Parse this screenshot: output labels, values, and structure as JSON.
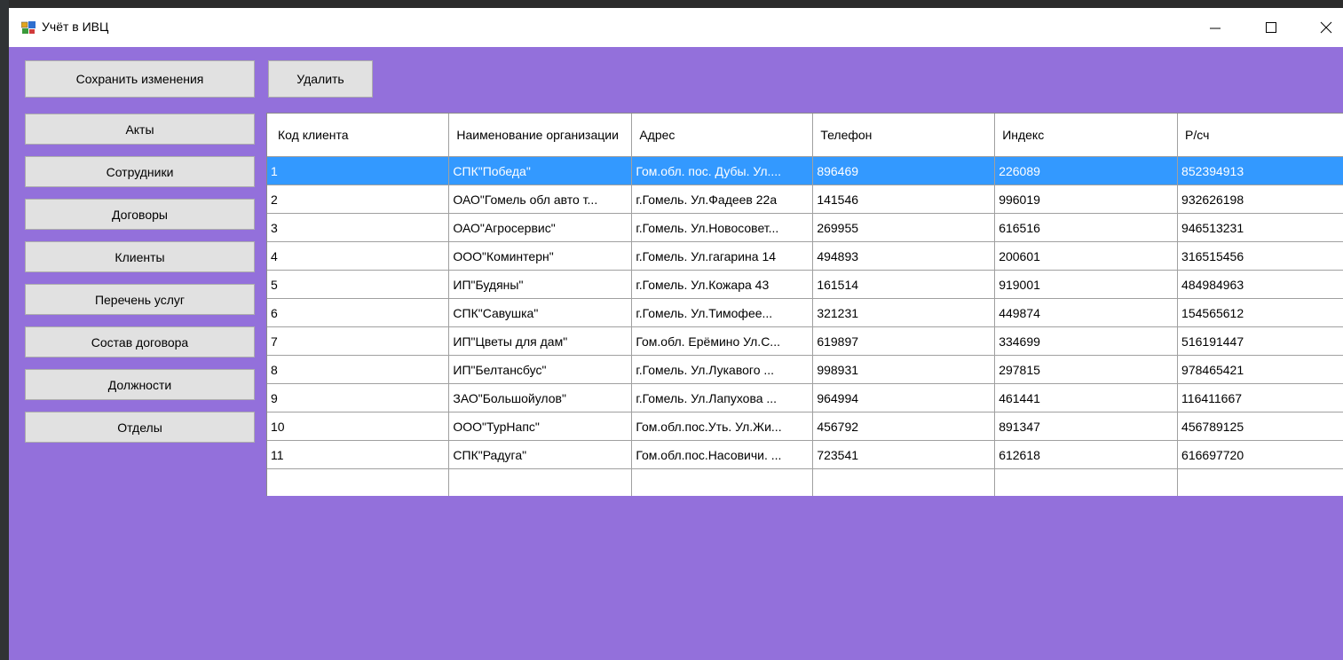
{
  "window": {
    "title": "Учёт в ИВЦ",
    "app_icon": "app-window-icon",
    "controls": [
      "minimize-icon",
      "maximize-icon",
      "close-icon"
    ]
  },
  "colors": {
    "client_background": "#9370db",
    "selection": "#3399ff",
    "button_face": "#e1e1e1"
  },
  "toolbar": {
    "save_label": "Сохранить изменения",
    "delete_label": "Удалить"
  },
  "nav": {
    "items": [
      {
        "label": "Акты"
      },
      {
        "label": "Сотрудники"
      },
      {
        "label": "Договоры"
      },
      {
        "label": "Клиенты"
      },
      {
        "label": "Перечень услуг"
      },
      {
        "label": "Состав договора"
      },
      {
        "label": "Должности"
      },
      {
        "label": "Отделы"
      }
    ]
  },
  "grid": {
    "columns": [
      "Код клиента",
      "Наименование организации",
      "Адрес",
      "Телефон",
      "Индекс",
      "Р/сч"
    ],
    "selected_row": 0,
    "rows": [
      [
        "1",
        "СПК\"Победа\"",
        "Гом.обл. пос. Дубы. Ул....",
        "896469",
        "226089",
        "852394913"
      ],
      [
        "2",
        "ОАО\"Гомель обл авто т...",
        "г.Гомель. Ул.Фадеев 22а",
        "141546",
        "996019",
        "932626198"
      ],
      [
        "3",
        "ОАО\"Агросервис\"",
        "г.Гомель. Ул.Новосовет...",
        "269955",
        "616516",
        "946513231"
      ],
      [
        "4",
        "ООО\"Коминтерн\"",
        "г.Гомель. Ул.гагарина 14",
        "494893",
        "200601",
        "316515456"
      ],
      [
        "5",
        "ИП\"Будяны\"",
        "г.Гомель. Ул.Кожара 43",
        "161514",
        "919001",
        "484984963"
      ],
      [
        "6",
        "СПК\"Савушка\"",
        "г.Гомель.  Ул.Тимофее...",
        "321231",
        "449874",
        "154565612"
      ],
      [
        "7",
        "ИП\"Цветы для дам\"",
        "Гом.обл. Ерёмино  Ул.С...",
        "619897",
        "334699",
        "516191447"
      ],
      [
        "8",
        "ИП\"Белтансбус\"",
        "г.Гомель.  Ул.Лукавого ...",
        "998931",
        "297815",
        "978465421"
      ],
      [
        "9",
        "ЗАО\"Большойулов\"",
        "г.Гомель.  Ул.Лапухова ...",
        "964994",
        "461441",
        "116411667"
      ],
      [
        "10",
        "ООО\"ТурНапс\"",
        "Гом.обл.пос.Уть. Ул.Жи...",
        "456792",
        "891347",
        "456789125"
      ],
      [
        "11",
        "СПК\"Радуга\"",
        "Гом.обл.пос.Насовичи. ...",
        "723541",
        "612618",
        "616697720"
      ]
    ]
  }
}
